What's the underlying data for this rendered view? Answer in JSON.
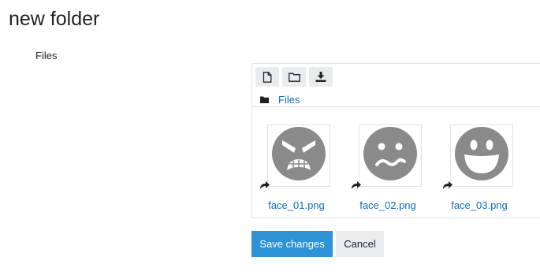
{
  "page": {
    "title": "new folder"
  },
  "form": {
    "files_label": "Files"
  },
  "filemanager": {
    "toolbar": {
      "add_file_icon": "file-icon",
      "create_folder_icon": "folder-outline-icon",
      "download_icon": "download-icon"
    },
    "breadcrumb": {
      "icon": "folder-icon",
      "path_label": "Files"
    },
    "files": [
      {
        "name": "face_01.png",
        "thumbnail": "angry-face-icon"
      },
      {
        "name": "face_02.png",
        "thumbnail": "wavy-mouth-face-icon"
      },
      {
        "name": "face_03.png",
        "thumbnail": "grinning-face-icon"
      }
    ]
  },
  "actions": {
    "save_label": "Save changes",
    "cancel_label": "Cancel"
  },
  "colors": {
    "primary": "#2d92d6",
    "link": "#0f6cbf",
    "secondary_bg": "#e9ecef",
    "face_gray": "#8a8a8a"
  }
}
